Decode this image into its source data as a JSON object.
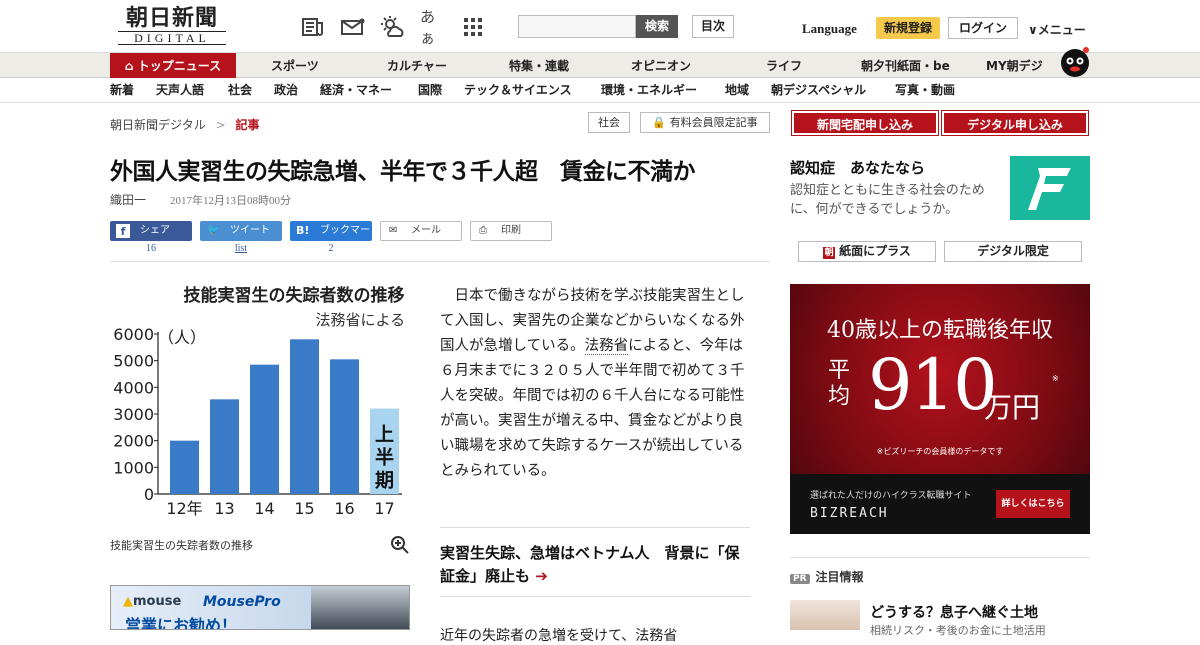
{
  "header": {
    "logo_jp": "朝日新聞",
    "logo_en": "DIGITAL",
    "icon_names": [
      "newspaper-icon",
      "mail-icon",
      "weather-icon",
      "font-size-icon",
      "grid-icon"
    ],
    "font_glyph": "あぁ",
    "search_button": "検索",
    "mokuji": "目次",
    "language": "Language",
    "register": "新規登録",
    "login": "ログイン",
    "menu": "メニュー"
  },
  "nav1": [
    "トップニュース",
    "スポーツ",
    "カルチャー",
    "特集・連載",
    "オピニオン",
    "ライフ",
    "朝夕刊紙面・be",
    "MY朝デジ"
  ],
  "nav2": [
    "新着",
    "天声人語",
    "社会",
    "政治",
    "経済・マネー",
    "国際",
    "テック＆サイエンス",
    "環境・エネルギー",
    "地域",
    "朝デジスペシャル",
    "写真・動画"
  ],
  "breadcrumb": {
    "home": "朝日新聞デジタル",
    "sep": ">",
    "current": "記事"
  },
  "tags": {
    "section": "社会",
    "paid": "有料会員限定記事"
  },
  "article": {
    "title": "外国人実習生の失踪急増、半年で３千人超　賃金に不満か",
    "author": "織田一",
    "date": "2017年12月13日08時00分",
    "share": {
      "facebook": "シェア",
      "facebook_count": "16",
      "twitter": "ツイート",
      "twitter_count": "list",
      "hatena": "ブックマーク",
      "hatena_count": "2",
      "mail": "メール",
      "print": "印刷"
    },
    "body_pre": "　日本で働きながら技術を学ぶ技能実習生として入国し、実習先の企業などからいなくなる外国人が急増している。",
    "body_link": "法務省",
    "body_post": "によると、今年は６月末までに３２０５人で半年間で初めて３千人を突破。年間では初の６千人台になる可能性が高い。実習生が増える中、賃金などがより良い職場を求めて失踪するケースが続出しているとみられている。",
    "related": "実習生失踪、急増はベトナム人　背景に「保証金」廃止も",
    "related_arrow": "➔",
    "next_para": "近年の失踪者の急増を受けて、法務省"
  },
  "chart_caption": "技能実習生の失踪者数の推移",
  "chart_data": {
    "type": "bar",
    "title": "技能実習生の失踪者数の推移",
    "subtitle": "法務省による",
    "ylabel": "（人）",
    "categories": [
      "12年",
      "13",
      "14",
      "15",
      "16",
      "17"
    ],
    "values": [
      2000,
      3550,
      4850,
      5800,
      5050,
      3205
    ],
    "ylim": [
      0,
      6000
    ],
    "yticks": [
      0,
      1000,
      2000,
      3000,
      4000,
      5000,
      6000
    ],
    "annotation": "上半期",
    "highlight_index": 5,
    "colors": {
      "bar": "#3a7bc8",
      "highlight": "#a9d4ef"
    }
  },
  "ad_left": {
    "brand": "mouse",
    "brand2": "MousePro",
    "copy": "営業にお勧め！"
  },
  "sidebar": {
    "btn1": "新聞宅配申し込み",
    "btn2": "デジタル申し込み",
    "nin_title": "認知症　あなたなら",
    "nin_desc": "認知症とともに生きる社会のために、何ができるでしょうか。",
    "plus": "紙面にプラス",
    "digital": "デジタル限定",
    "ad": {
      "headline": "40歳以上の転職後年収",
      "avg": "平均",
      "amount": "910",
      "unit": "万円",
      "mark": "※",
      "note": "※ビズリーチの会員様のデータです",
      "sub": "選ばれた人だけのハイクラス転職サイト",
      "brand": "BIZREACH",
      "cta": "詳しくはこちら"
    },
    "pr_badge": "PR",
    "pr_label": "注目情報",
    "pr_title": "どうする？息子へ継ぐ土地",
    "pr_desc": "相続リスク・考後のお金に土地活用"
  }
}
